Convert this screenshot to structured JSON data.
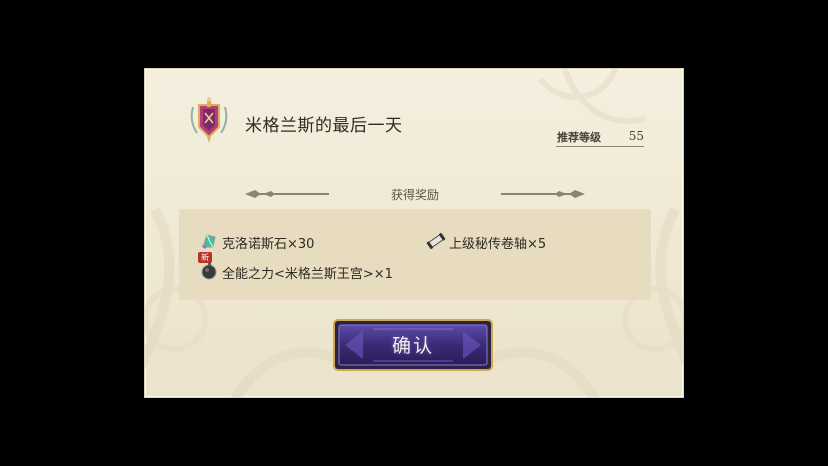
{
  "quest": {
    "title": "米格兰斯的最后一天",
    "recommended_level_label": "推荐等级",
    "recommended_level_value": "55"
  },
  "rewards": {
    "header": "获得奖励",
    "items": [
      {
        "icon": "crystal-icon",
        "label": "克洛诺斯石×30",
        "is_new": false
      },
      {
        "icon": "scroll-icon",
        "label": "上级秘传卷轴×5",
        "is_new": false
      },
      {
        "icon": "bomb-icon",
        "label": "全能之力<米格兰斯王宫>×1",
        "is_new": true,
        "badge": "新"
      }
    ]
  },
  "confirm_button": {
    "label": "确认"
  },
  "colors": {
    "panel": "#f1ebd8",
    "reward_box": "#e7dcbf",
    "button_fill": "#3f2f7c",
    "button_border": "#d6b05a",
    "badge": "#b83228"
  }
}
